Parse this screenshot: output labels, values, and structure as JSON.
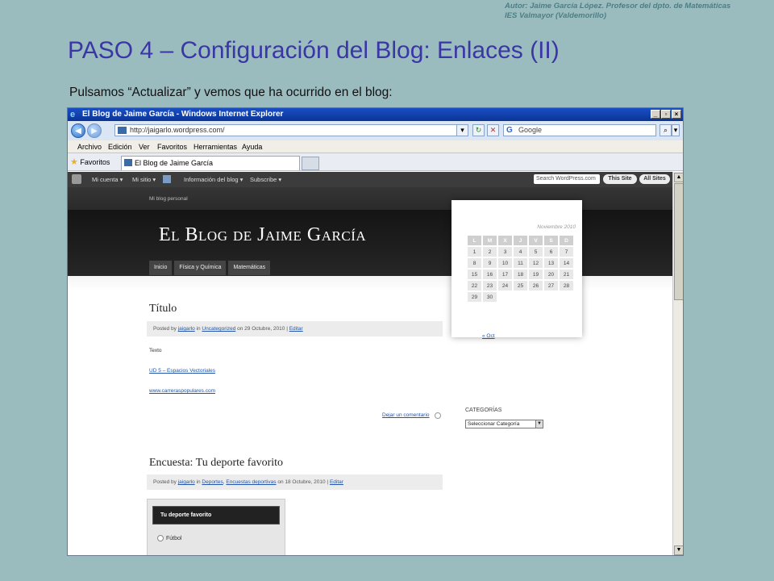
{
  "slide": {
    "author_line1": "Autor: Jaime García López. Profesor del dpto. de Matemáticas",
    "author_line2": "IES Valmayor (Valdemorillo)",
    "title": "PASO 4 – Configuración del Blog: Enlaces (II)",
    "subtitle": "Pulsamos “Actualizar” y vemos que ha ocurrido en el blog:"
  },
  "browser": {
    "window_title": "El Blog de Jaime García - Windows Internet Explorer",
    "url": "http://jaigarlo.wordpress.com/",
    "search_placeholder": "Google",
    "menu": [
      "Archivo",
      "Edición",
      "Ver",
      "Favoritos",
      "Herramientas",
      "Ayuda"
    ],
    "favorites_label": "Favoritos",
    "tab_title": "El Blog de Jaime García"
  },
  "wp_toolbar": {
    "items": [
      "Mi cuenta ▾",
      "Mi sitio ▾",
      "Información del blog ▾",
      "Subscribe ▾"
    ],
    "search_placeholder": "Search WordPress.com",
    "this_site": "This Site",
    "all_sites": "All Sites"
  },
  "blog": {
    "tagline": "Mi blog personal",
    "title": "El Blog de Jaime García",
    "nav": [
      "Inicio",
      "Física y Química",
      "Matemáticas"
    ],
    "posts": [
      {
        "title": "Título",
        "meta_prefix": "Posted by",
        "author": "jaigarlo",
        "meta_in": "in",
        "category": "Uncategorized",
        "date": "on 29 Octubre, 2010 |",
        "edit": "Editar",
        "text": "Texto",
        "link1": "UD 5 – Espacios Vectoriales",
        "link2": "www.carreraspopulares.com",
        "comment": "Dejar un comentario"
      },
      {
        "title": "Encuesta: Tu deporte favorito",
        "meta_prefix": "Posted by",
        "author": "jaigarlo",
        "meta_in": "in",
        "category": "Deportes",
        "category2": "Encuestas deportivas",
        "date": "on 18 Octubre, 2010 |",
        "edit": "Editar"
      }
    ],
    "poll": {
      "header": "Tu deporte favorito",
      "option": "Fútbol"
    }
  },
  "calendar": {
    "month": "Noviembre 2010",
    "days": [
      "L",
      "M",
      "X",
      "J",
      "V",
      "S",
      "D"
    ],
    "weeks": [
      [
        "1",
        "2",
        "3",
        "4",
        "5",
        "6",
        "7"
      ],
      [
        "8",
        "9",
        "10",
        "11",
        "12",
        "13",
        "14"
      ],
      [
        "15",
        "16",
        "17",
        "18",
        "19",
        "20",
        "21"
      ],
      [
        "22",
        "23",
        "24",
        "25",
        "26",
        "27",
        "28"
      ],
      [
        "29",
        "30",
        "",
        "",
        "",
        "",
        ""
      ]
    ],
    "prev": "« Oct"
  },
  "categories": {
    "title": "CATEGORÍAS",
    "select_value": "Seleccionar Categoría"
  }
}
